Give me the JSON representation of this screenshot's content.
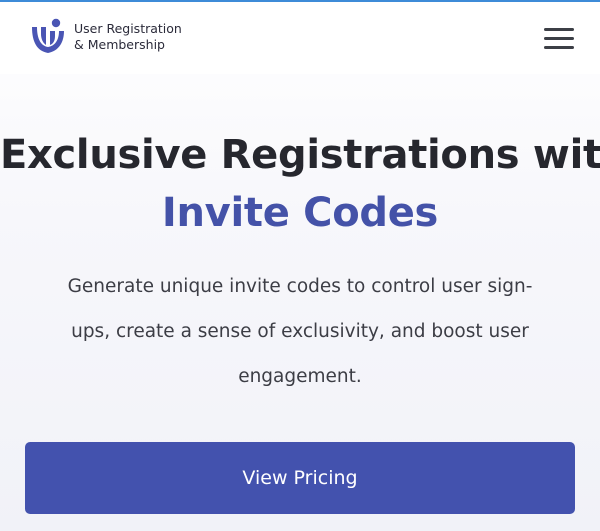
{
  "brand": {
    "name_line1": "User Registration",
    "name_line2": "& Membership",
    "logo_icon": "urm-logo-icon"
  },
  "header": {
    "menu_icon": "hamburger-menu-icon"
  },
  "hero": {
    "title_line1": "Exclusive Registrations with",
    "title_line2": "Invite Codes",
    "description_line1": "Generate unique invite codes to control user sign-",
    "description_line2": "ups, create a sense of exclusivity, and boost user",
    "description_line3": "engagement.",
    "cta_label": "View Pricing"
  },
  "colors": {
    "accent": "#4452a8",
    "button": "#4352ae",
    "text_dark": "#26272e",
    "top_border": "#3d8bd8"
  }
}
